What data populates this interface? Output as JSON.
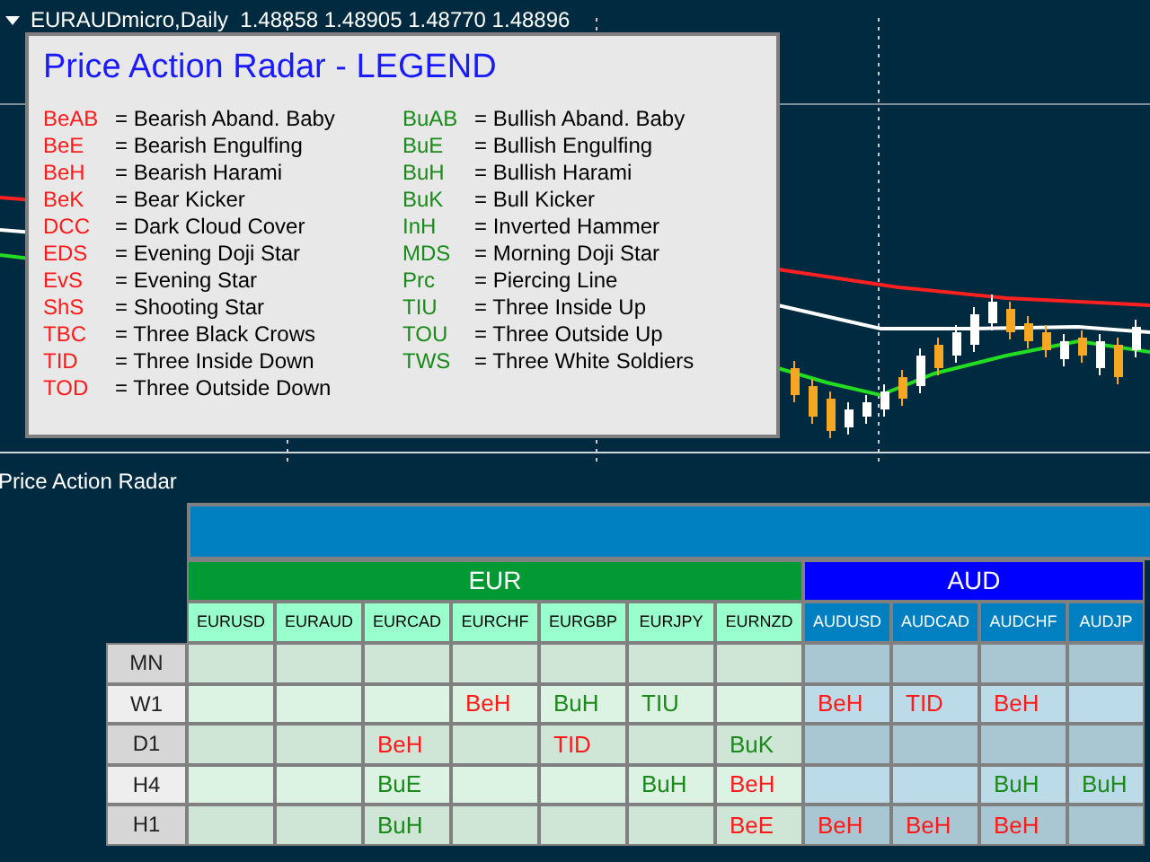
{
  "chart": {
    "header": "EURAUDmicro,Daily  1.48858 1.48905 1.48770 1.48896"
  },
  "legend": {
    "title": "Price Action Radar - LEGEND",
    "columns": [
      [
        {
          "code": "BeAB",
          "meaning": "= Bearish Aband. Baby",
          "kind": "bearish"
        },
        {
          "code": "BeE",
          "meaning": "= Bearish Engulfing",
          "kind": "bearish"
        },
        {
          "code": "BeH",
          "meaning": "= Bearish Harami",
          "kind": "bearish"
        },
        {
          "code": "BeK",
          "meaning": "= Bear Kicker",
          "kind": "bearish"
        },
        {
          "code": "DCC",
          "meaning": "= Dark Cloud Cover",
          "kind": "bearish"
        },
        {
          "code": "EDS",
          "meaning": "= Evening Doji Star",
          "kind": "bearish"
        },
        {
          "code": "EvS",
          "meaning": "= Evening Star",
          "kind": "bearish"
        },
        {
          "code": "ShS",
          "meaning": "= Shooting Star",
          "kind": "bearish"
        },
        {
          "code": "TBC",
          "meaning": "= Three Black Crows",
          "kind": "bearish"
        },
        {
          "code": "TID",
          "meaning": "= Three Inside Down",
          "kind": "bearish"
        },
        {
          "code": "TOD",
          "meaning": "= Three Outside Down",
          "kind": "bearish"
        }
      ],
      [
        {
          "code": "BuAB",
          "meaning": "= Bullish Aband. Baby",
          "kind": "bullish"
        },
        {
          "code": "BuE",
          "meaning": "= Bullish Engulfing",
          "kind": "bullish"
        },
        {
          "code": "BuH",
          "meaning": "= Bullish Harami",
          "kind": "bullish"
        },
        {
          "code": "BuK",
          "meaning": "= Bull Kicker",
          "kind": "bullish"
        },
        {
          "code": "InH",
          "meaning": "= Inverted Hammer",
          "kind": "bullish"
        },
        {
          "code": "MDS",
          "meaning": "= Morning Doji Star",
          "kind": "bullish"
        },
        {
          "code": "Prc",
          "meaning": "= Piercing Line",
          "kind": "bullish"
        },
        {
          "code": "TIU",
          "meaning": "= Three Inside Up",
          "kind": "bullish"
        },
        {
          "code": "TOU",
          "meaning": "= Three Outside Up",
          "kind": "bullish"
        },
        {
          "code": "TWS",
          "meaning": "= Three White Soldiers",
          "kind": "bullish"
        }
      ]
    ]
  },
  "radar": {
    "title": "Price Action Radar",
    "groups": [
      {
        "name": "EUR",
        "color": "#009933",
        "pairs": [
          "EURUSD",
          "EURAUD",
          "EURCAD",
          "EURCHF",
          "EURGBP",
          "EURJPY",
          "EURNZD"
        ]
      },
      {
        "name": "AUD",
        "color": "#0000ff",
        "pairs": [
          "AUDUSD",
          "AUDCAD",
          "AUDCHF",
          "AUDJP"
        ]
      }
    ],
    "rows": [
      {
        "label": "MN",
        "cells": [
          null,
          null,
          null,
          null,
          null,
          null,
          null,
          null,
          null,
          null,
          null
        ]
      },
      {
        "label": "W1",
        "cells": [
          null,
          null,
          null,
          {
            "code": "BeH",
            "kind": "bearish"
          },
          {
            "code": "BuH",
            "kind": "bullish"
          },
          {
            "code": "TIU",
            "kind": "bullish"
          },
          null,
          {
            "code": "BeH",
            "kind": "bearish"
          },
          {
            "code": "TID",
            "kind": "bearish"
          },
          {
            "code": "BeH",
            "kind": "bearish"
          },
          null
        ]
      },
      {
        "label": "D1",
        "cells": [
          null,
          null,
          {
            "code": "BeH",
            "kind": "bearish"
          },
          null,
          {
            "code": "TID",
            "kind": "bearish"
          },
          null,
          {
            "code": "BuK",
            "kind": "bullish"
          },
          null,
          null,
          null,
          null
        ]
      },
      {
        "label": "H4",
        "cells": [
          null,
          null,
          {
            "code": "BuE",
            "kind": "bullish"
          },
          null,
          null,
          {
            "code": "BuH",
            "kind": "bullish"
          },
          {
            "code": "BeH",
            "kind": "bearish"
          },
          null,
          null,
          {
            "code": "BuH",
            "kind": "bullish"
          },
          {
            "code": "BuH",
            "kind": "bullish"
          }
        ]
      },
      {
        "label": "H1",
        "cells": [
          null,
          null,
          {
            "code": "BuH",
            "kind": "bullish"
          },
          null,
          null,
          null,
          {
            "code": "BeE",
            "kind": "bearish"
          },
          {
            "code": "BeH",
            "kind": "bearish"
          },
          {
            "code": "BeH",
            "kind": "bearish"
          },
          {
            "code": "BeH",
            "kind": "bearish"
          },
          null
        ]
      }
    ]
  }
}
